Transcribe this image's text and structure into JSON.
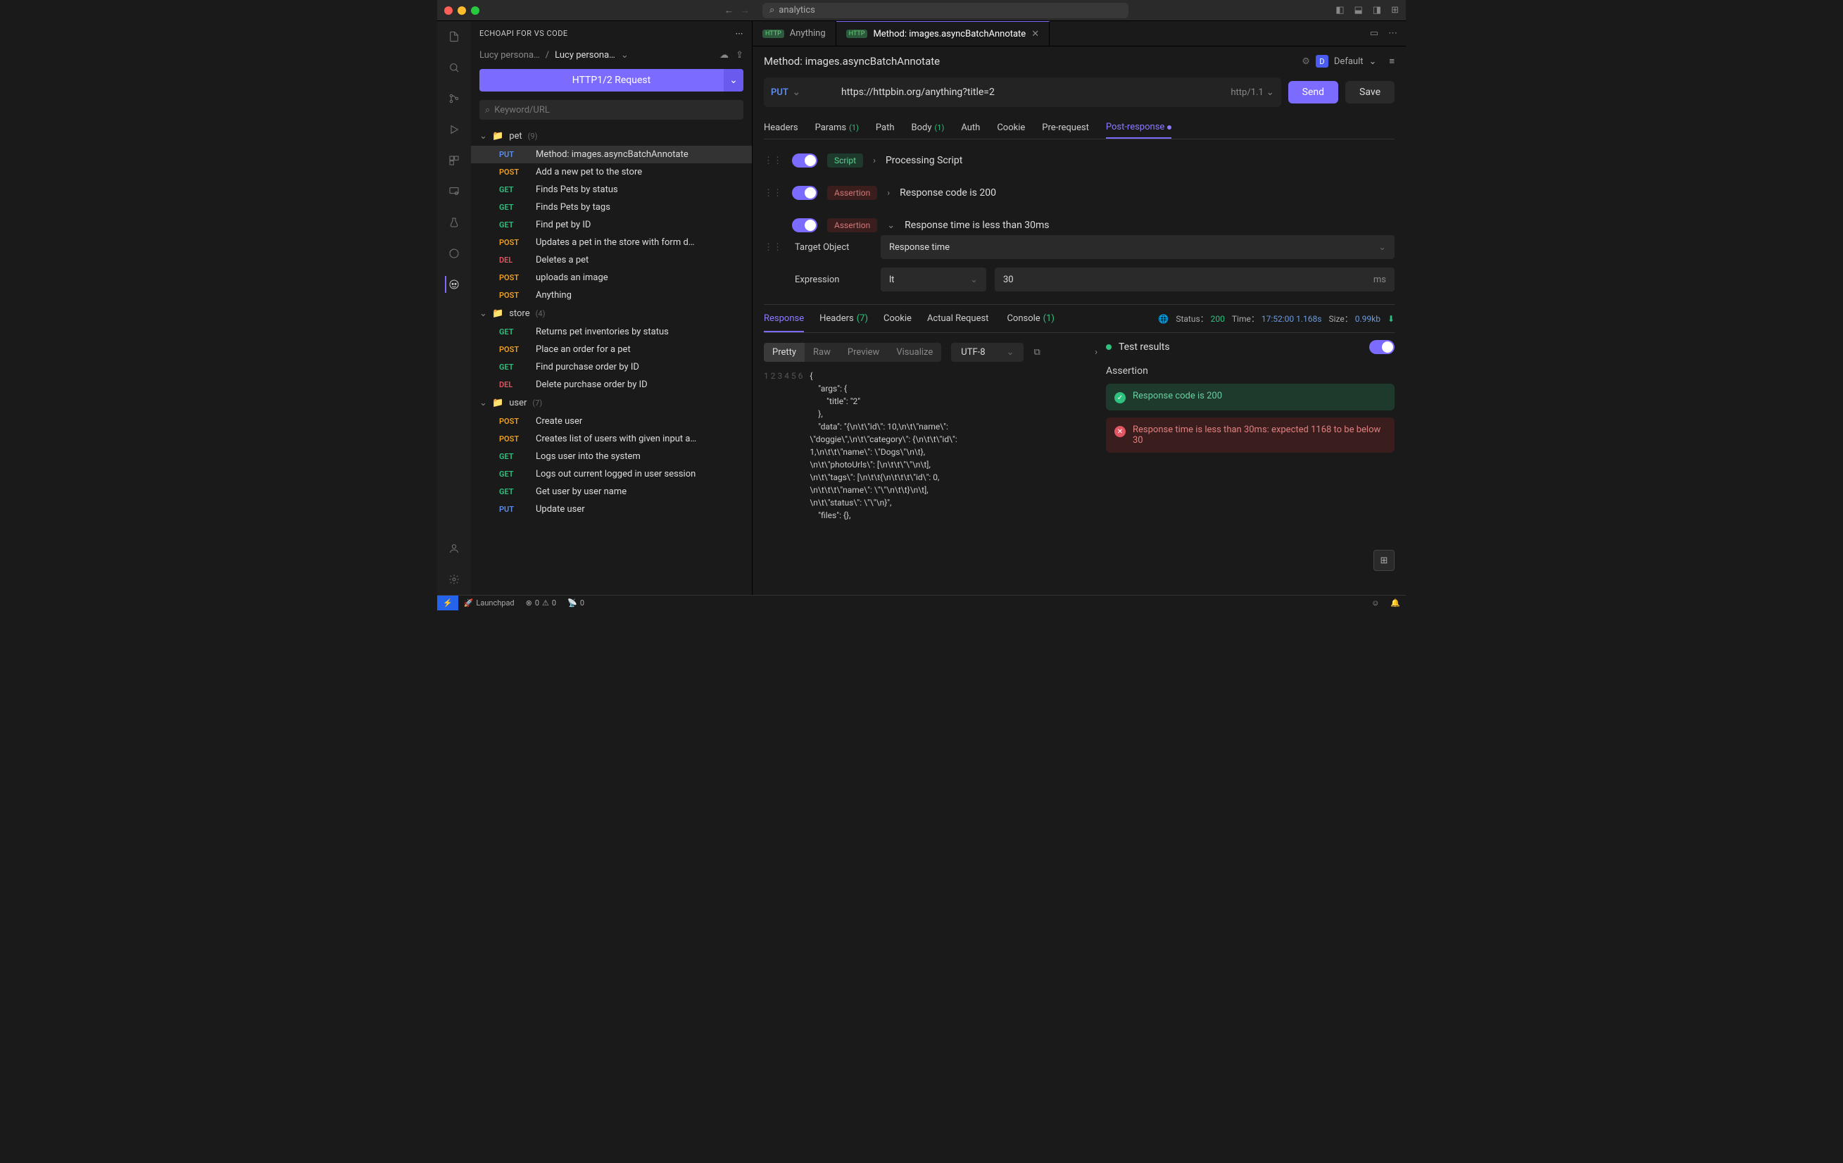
{
  "titlebar": {
    "search": "analytics"
  },
  "sidebar": {
    "title": "ECHOAPI FOR VS CODE",
    "breadcrumb1": "Lucy persona…",
    "breadcrumb2": "Lucy persona…",
    "request_btn": "HTTP1/2 Request",
    "search_placeholder": "Keyword/URL",
    "folders": [
      {
        "name": "pet",
        "count": "(9)",
        "items": [
          {
            "method": "PUT",
            "name": "Method: images.asyncBatchAnnotate",
            "selected": true
          },
          {
            "method": "POST",
            "name": "Add a new pet to the store"
          },
          {
            "method": "GET",
            "name": "Finds Pets by status"
          },
          {
            "method": "GET",
            "name": "Finds Pets by tags"
          },
          {
            "method": "GET",
            "name": "Find pet by ID"
          },
          {
            "method": "POST",
            "name": "Updates a pet in the store with form d…"
          },
          {
            "method": "DEL",
            "name": "Deletes a pet"
          },
          {
            "method": "POST",
            "name": "uploads an image"
          },
          {
            "method": "POST",
            "name": "Anything"
          }
        ]
      },
      {
        "name": "store",
        "count": "(4)",
        "items": [
          {
            "method": "GET",
            "name": "Returns pet inventories by status"
          },
          {
            "method": "POST",
            "name": "Place an order for a pet"
          },
          {
            "method": "GET",
            "name": "Find purchase order by ID"
          },
          {
            "method": "DEL",
            "name": "Delete purchase order by ID"
          }
        ]
      },
      {
        "name": "user",
        "count": "(7)",
        "items": [
          {
            "method": "POST",
            "name": "Create user"
          },
          {
            "method": "POST",
            "name": "Creates list of users with given input a…"
          },
          {
            "method": "GET",
            "name": "Logs user into the system"
          },
          {
            "method": "GET",
            "name": "Logs out current logged in user session"
          },
          {
            "method": "GET",
            "name": "Get user by user name"
          },
          {
            "method": "PUT",
            "name": "Update user"
          }
        ]
      }
    ]
  },
  "tabs": [
    {
      "label": "Anything",
      "active": false
    },
    {
      "label": "Method: images.asyncBatchAnnotate",
      "active": true
    }
  ],
  "page": {
    "title": "Method: images.asyncBatchAnnotate",
    "env": "Default",
    "method": "PUT",
    "url": "https://httpbin.org/anything?title=2",
    "protocol": "http/1.1",
    "send": "Send",
    "save": "Save"
  },
  "reqtabs": {
    "headers": "Headers",
    "params": "Params",
    "params_cnt": "(1)",
    "path": "Path",
    "body": "Body",
    "body_cnt": "(1)",
    "auth": "Auth",
    "cookie": "Cookie",
    "prereq": "Pre-request",
    "postresp": "Post-response"
  },
  "assertions": {
    "a1": {
      "tag": "Script",
      "label": "Processing Script"
    },
    "a2": {
      "tag": "Assertion",
      "label": "Response code is 200"
    },
    "a3": {
      "tag": "Assertion",
      "label": "Response time is less than 30ms",
      "target_lbl": "Target Object",
      "target_val": "Response time",
      "expr_lbl": "Expression",
      "expr_val": "lt",
      "value": "30",
      "unit": "ms"
    }
  },
  "response": {
    "tabs": {
      "response": "Response",
      "headers": "Headers",
      "headers_cnt": "(7)",
      "cookie": "Cookie",
      "actual": "Actual Request",
      "console": "Console",
      "console_cnt": "(1)"
    },
    "status_lbl": "Status：",
    "status_code": "200",
    "time_lbl": "Time：",
    "time_clock": "17:52:00",
    "time_dur": "1.168s",
    "size_lbl": "Size：",
    "size_val": "0.99kb",
    "view": {
      "pretty": "Pretty",
      "raw": "Raw",
      "preview": "Preview",
      "visualize": "Visualize"
    },
    "encoding": "UTF-8",
    "code_lines": [
      "1",
      "2",
      "3",
      "4",
      "5",
      "",
      "",
      "",
      "",
      "",
      "6"
    ],
    "code": "{\n    \"args\": {\n        \"title\": \"2\"\n    },\n    \"data\": \"{\\n\\t\\\"id\\\": 10,\\n\\t\\\"name\\\":\n\\\"doggie\\\",\\n\\t\\\"category\\\": {\\n\\t\\t\\\"id\\\":\n1,\\n\\t\\t\\\"name\\\": \\\"Dogs\\\"\\n\\t},\n\\n\\t\\\"photoUrls\\\": [\\n\\t\\t\\\"\\\"\\n\\t],\n\\n\\t\\\"tags\\\": [\\n\\t\\t{\\n\\t\\t\\t\\\"id\\\": 0,\n\\n\\t\\t\\t\\\"name\\\": \\\"\\\"\\n\\t\\t}\\n\\t],\n\\n\\t\\\"status\\\": \\\"\\\"\\n}\",\n    \"files\": {},",
    "test_results": "Test results",
    "section": "Assertion",
    "pass": "Response code is 200",
    "fail": "Response time is less than 30ms: expected 1168 to be below 30"
  },
  "statusbar": {
    "launchpad": "Launchpad",
    "errors": "0",
    "warnings": "0",
    "ports": "0"
  }
}
